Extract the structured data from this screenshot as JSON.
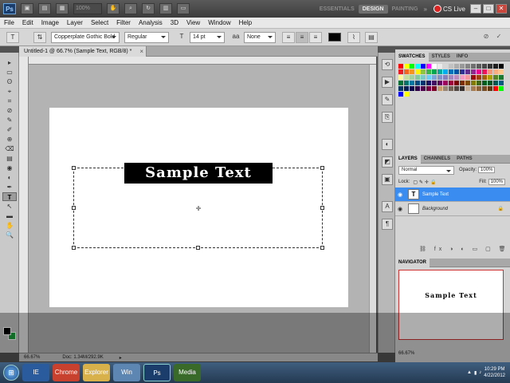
{
  "titlebar": {
    "app_logo": "Ps",
    "zoom": "100%",
    "workspaces": {
      "essentials": "ESSENTIALS",
      "design": "DESIGN",
      "painting": "PAINTING",
      "more": "»"
    },
    "cs_live": "CS Live",
    "window_buttons": {
      "minimize": "–",
      "maximize": "□",
      "close": "✕"
    }
  },
  "menubar": {
    "items": [
      "File",
      "Edit",
      "Image",
      "Layer",
      "Select",
      "Filter",
      "Analysis",
      "3D",
      "View",
      "Window",
      "Help"
    ]
  },
  "options": {
    "tool_icon": "T",
    "font_family": "Copperplate Gothic Bold",
    "font_style": "Regular",
    "font_size": "14 pt",
    "antialias": "None",
    "size_icon": "T",
    "text_color": "#000000"
  },
  "document": {
    "tab_title": "Untitled-1 @ 66.7% (Sample Text, RGB/8) *",
    "close_label": "×",
    "canvas_text": "Sample Text",
    "status_zoom": "66.67%",
    "status_doc": "Doc: 1.34M/292.9K"
  },
  "toolbox": {
    "tools": [
      "▸",
      "▭",
      "ʘ",
      "⌖",
      "⌗",
      "⊘",
      "✎",
      "✐",
      "⊕",
      "⌫",
      "▤",
      "◉",
      "◐",
      "✒",
      "T",
      "↖",
      "▬",
      "✋",
      "🔍"
    ],
    "fg_color": "#000000",
    "bg_color": "#1da13c"
  },
  "panels": {
    "swatches_tabs": [
      "SWATCHES",
      "STYLES",
      "INFO"
    ],
    "layers_tabs": [
      "LAYERS",
      "CHANNELS",
      "PATHS"
    ],
    "blend_mode": "Normal",
    "opacity_label": "Opacity:",
    "opacity_value": "100%",
    "lock_label": "Lock:",
    "fill_label": "Fill:",
    "fill_value": "100%",
    "layers": [
      {
        "name": "Sample Text",
        "thumb": "T",
        "selected": true
      },
      {
        "name": "Background",
        "thumb": "",
        "selected": false
      }
    ],
    "navigator_tab": "NAVIGATOR",
    "navigator_text": "Sample Text",
    "navigator_zoom": "66.67%"
  },
  "taskbar": {
    "start": "⊞",
    "apps": [
      "IE",
      "Chrome",
      "Explorer",
      "Win",
      "Ps",
      "Media"
    ],
    "time": "10:29 PM",
    "date": "4/22/2012"
  },
  "swatch_colors": [
    "#ff0000",
    "#ffff00",
    "#00ff00",
    "#00ffff",
    "#0000ff",
    "#ff00ff",
    "#ffffff",
    "#ebebeb",
    "#d6d6d6",
    "#c2c2c2",
    "#adadad",
    "#999999",
    "#858585",
    "#707070",
    "#5c5c5c",
    "#474747",
    "#333333",
    "#1f1f1f",
    "#000000",
    "#ed1c24",
    "#f26522",
    "#f7941d",
    "#fff200",
    "#8dc63f",
    "#39b54a",
    "#00a651",
    "#00a99d",
    "#00aeef",
    "#0072bc",
    "#0054a6",
    "#2e3192",
    "#662d91",
    "#92278f",
    "#ec008c",
    "#ed145b",
    "#f69679",
    "#f9ad81",
    "#fdc68a",
    "#fff799",
    "#c4df9b",
    "#a3d39c",
    "#82ca9c",
    "#7accc8",
    "#6dcff6",
    "#7da7d9",
    "#8393ca",
    "#8781bd",
    "#a187be",
    "#bd8cbf",
    "#f49ac2",
    "#f6989d",
    "#9e0b0f",
    "#a0410d",
    "#a36209",
    "#aba000",
    "#598527",
    "#1a7b30",
    "#007236",
    "#00746b",
    "#0076a3",
    "#004b80",
    "#003471",
    "#1b1464",
    "#440e62",
    "#630460",
    "#9e005d",
    "#9e0039",
    "#790000",
    "#7b2e00",
    "#7d4900",
    "#827b00",
    "#406618",
    "#005e20",
    "#005826",
    "#005952",
    "#005b7f",
    "#003663",
    "#002157",
    "#0d004c",
    "#32004b",
    "#4b0049",
    "#7b0046",
    "#7a0026",
    "#c69c6d",
    "#998675",
    "#736357",
    "#534741",
    "#362f2d",
    "#c7b299",
    "#a67c52",
    "#8c6239",
    "#754c24",
    "#603913",
    "#ff0000",
    "#00ff00",
    "#0000ff",
    "#ffff00"
  ]
}
